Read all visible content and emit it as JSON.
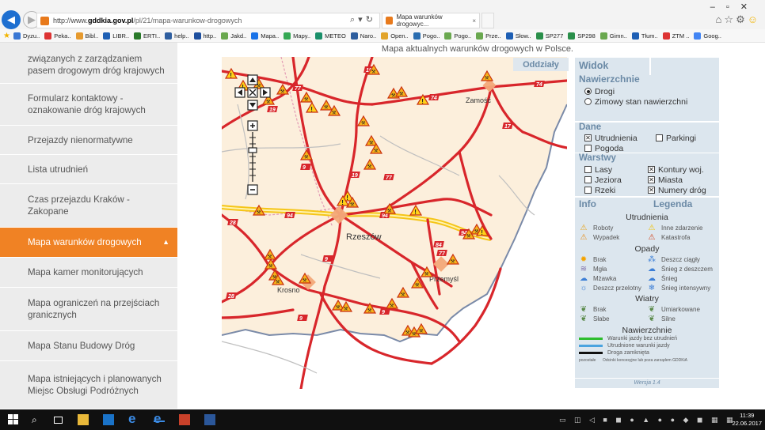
{
  "browser": {
    "url_prefix": "http://www.",
    "url_domain": "gddkia.gov.pl",
    "url_rest": "/pl/21/mapa-warunkow-drogowych",
    "tab_title": "Mapa warunków drogowyc...",
    "favorites": [
      {
        "label": "Dyzu..",
        "color": "#3a78d4"
      },
      {
        "label": "Peka..",
        "color": "#d33"
      },
      {
        "label": "Bibl..",
        "color": "#e69a2e"
      },
      {
        "label": "LIBR..",
        "color": "#1e5fb4"
      },
      {
        "label": "ERTI..",
        "color": "#2a7a2a"
      },
      {
        "label": "help..",
        "color": "#2f5fa0"
      },
      {
        "label": "http..",
        "color": "#1e4f9e"
      },
      {
        "label": "Jakd..",
        "color": "#6aa84f"
      },
      {
        "label": "Mapa..",
        "color": "#1a73e8"
      },
      {
        "label": "Mapy..",
        "color": "#34a853"
      },
      {
        "label": "METEO",
        "color": "#1a8f6a"
      },
      {
        "label": "Naro..",
        "color": "#2d5e9e"
      },
      {
        "label": "Open..",
        "color": "#e2a42b"
      },
      {
        "label": "Pogo..",
        "color": "#2a6db0"
      },
      {
        "label": "Pogo..",
        "color": "#6aa84f"
      },
      {
        "label": "Prze..",
        "color": "#6aa84f"
      },
      {
        "label": "Słow..",
        "color": "#1e5fb4"
      },
      {
        "label": "SP277",
        "color": "#2a8f4a"
      },
      {
        "label": "SP298",
        "color": "#2a8f4a"
      },
      {
        "label": "Gimn..",
        "color": "#6aa84f"
      },
      {
        "label": "Tłum..",
        "color": "#1e5fb4"
      },
      {
        "label": "ZTM ..",
        "color": "#d33"
      },
      {
        "label": "Goog..",
        "color": "#4285f4"
      }
    ]
  },
  "sidebar": {
    "items": [
      {
        "label": "związanych z zarządzaniem pasem drogowym dróg krajowych"
      },
      {
        "label": "Formularz kontaktowy - oznakowanie dróg krajowych"
      },
      {
        "label": "Przejazdy nienormatywne"
      },
      {
        "label": "Lista utrudnień"
      },
      {
        "label": "Czas przejazdu Kraków - Zakopane"
      },
      {
        "label": "Mapa warunków drogowych",
        "active": true
      },
      {
        "label": "Mapa kamer monitorujących"
      },
      {
        "label": "Mapa ograniczeń na przejściach granicznych"
      },
      {
        "label": "Mapa Stanu Budowy Dróg"
      },
      {
        "label": "Mapa istniejących i planowanych Miejsc Obsługi Podróżnych"
      }
    ]
  },
  "map": {
    "caption": "Mapa aktualnych warunków drogowych w Polsce.",
    "oddzialy": "Oddziały",
    "cities": [
      {
        "name": "Zamość"
      },
      {
        "name": "Rzeszów"
      },
      {
        "name": "Krosno"
      },
      {
        "name": "Przemyśl"
      }
    ],
    "road_numbers": [
      "74",
      "19",
      "77",
      "19",
      "74",
      "17",
      "9",
      "19",
      "77",
      "94",
      "94",
      "94",
      "84",
      "77",
      "9",
      "28",
      "28",
      "9",
      "9"
    ]
  },
  "panel": {
    "widok": "Widok",
    "nawierzchnie_title": "Nawierzchnie",
    "nawierzchnie": [
      {
        "label": "Drogi",
        "selected": true
      },
      {
        "label": "Zimowy stan nawierzchni",
        "selected": false
      }
    ],
    "dane_title": "Dane",
    "dane": [
      {
        "label": "Utrudnienia",
        "checked": true
      },
      {
        "label": "Parkingi",
        "checked": false
      },
      {
        "label": "Pogoda",
        "checked": false
      }
    ],
    "warstwy_title": "Warstwy",
    "warstwy": [
      {
        "label": "Lasy",
        "checked": false
      },
      {
        "label": "Kontury woj.",
        "checked": true
      },
      {
        "label": "Jeziora",
        "checked": false
      },
      {
        "label": "Miasta",
        "checked": true
      },
      {
        "label": "Rzeki",
        "checked": false
      },
      {
        "label": "Numery dróg",
        "checked": true
      }
    ],
    "info_tab": "Info",
    "legenda_tab": "Legenda",
    "utrudnienia_title": "Utrudnienia",
    "utrudnienia": [
      {
        "label": "Roboty",
        "icon": "roadwork-icon"
      },
      {
        "label": "Inne zdarzenie",
        "icon": "warning-icon"
      },
      {
        "label": "Wypadek",
        "icon": "accident-icon"
      },
      {
        "label": "Katastrofa",
        "icon": "disaster-icon"
      }
    ],
    "opady_title": "Opady",
    "opady": [
      {
        "label": "Brak",
        "icon": "sun-icon"
      },
      {
        "label": "Deszcz ciągły",
        "icon": "rain-icon"
      },
      {
        "label": "Mgła",
        "icon": "fog-icon"
      },
      {
        "label": "Śnieg z deszczem",
        "icon": "sleet-icon"
      },
      {
        "label": "Mżawka",
        "icon": "drizzle-icon"
      },
      {
        "label": "Śnieg",
        "icon": "snow-icon"
      },
      {
        "label": "Deszcz przelotny",
        "icon": "shower-icon"
      },
      {
        "label": "Śnieg intensywny",
        "icon": "heavy-snow-icon"
      }
    ],
    "wiatry_title": "Wiatry",
    "wiatry": [
      {
        "label": "Brak",
        "icon": "no-wind-icon"
      },
      {
        "label": "Umiarkowane",
        "icon": "moderate-wind-icon"
      },
      {
        "label": "Słabe",
        "icon": "weak-wind-icon"
      },
      {
        "label": "Silne",
        "icon": "strong-wind-icon"
      }
    ],
    "nawierzchnie_leg_title": "Nawierzchnie",
    "nawierzchnie_leg": [
      {
        "label": "Warunki jazdy bez utrudnień",
        "color": "#2dbd2d"
      },
      {
        "label": "Utrudnione warunki jazdy",
        "color": "#4aa3df"
      },
      {
        "label": "Droga zamknięta",
        "color": "#111111"
      }
    ],
    "zarzad_left": "pozostałe",
    "zarzad_right": "Odcinki koncesyjne lub poza zarządem GDDKiA",
    "version": "Wersja 1.4"
  },
  "taskbar": {
    "time": "11:39",
    "date": "22.06.2017"
  }
}
